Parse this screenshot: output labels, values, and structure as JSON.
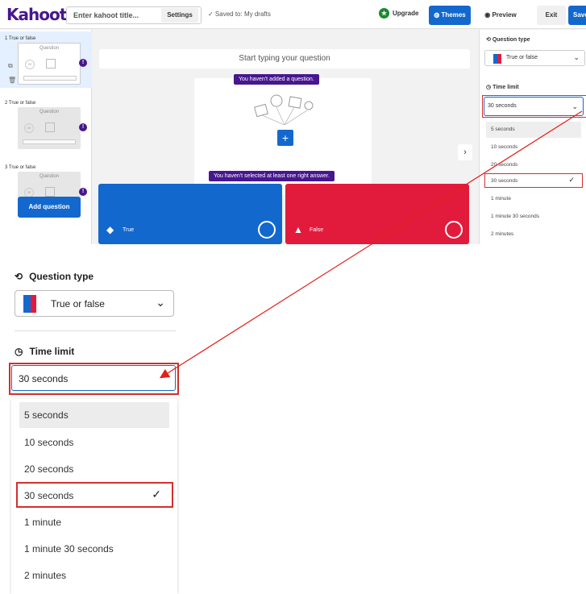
{
  "header": {
    "logo": "Kahoot!",
    "title_placeholder": "Enter kahoot title...",
    "settings": "Settings",
    "saved": "✓ Saved to: My drafts",
    "upgrade": "Upgrade",
    "themes": "Themes",
    "preview": "Preview",
    "exit": "Exit",
    "save": "Save"
  },
  "slides": [
    {
      "label": "1  True or false",
      "question": "Question"
    },
    {
      "label": "2  True or false",
      "question": "Question"
    },
    {
      "label": "3  True or false",
      "question": "Question"
    }
  ],
  "add_question": "Add question",
  "editor": {
    "question_placeholder": "Start typing your question",
    "tooltip_question": "You haven't added a question.",
    "tooltip_answer": "You haven't selected at least one right answer.",
    "answer_true": "True",
    "answer_false": "False"
  },
  "right_panel": {
    "question_type_heading": "Question type",
    "question_type_value": "True or false",
    "time_limit_heading": "Time limit",
    "time_limit_value": "30 seconds",
    "options": [
      "5 seconds",
      "10 seconds",
      "20 seconds",
      "30 seconds",
      "1 minute",
      "1 minute 30 seconds",
      "2 minutes"
    ],
    "selected_option": "30 seconds"
  },
  "zoom": {
    "question_type_heading": "Question type",
    "question_type_value": "True or false",
    "time_limit_heading": "Time limit",
    "time_limit_value": "30 seconds",
    "options": [
      "5 seconds",
      "10 seconds",
      "20 seconds",
      "30 seconds",
      "1 minute",
      "1 minute 30 seconds",
      "2 minutes"
    ]
  },
  "colors": {
    "brand_purple": "#46178f",
    "primary_blue": "#1368ce",
    "answer_red": "#e21b3c",
    "highlight_red": "#d32f2f"
  }
}
